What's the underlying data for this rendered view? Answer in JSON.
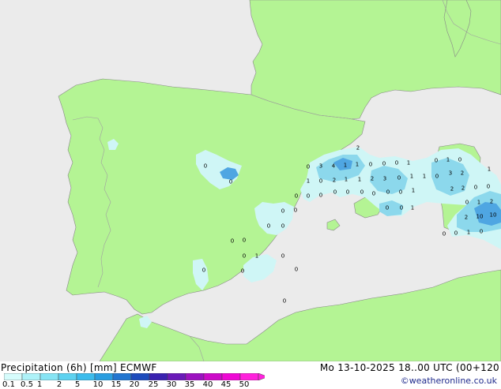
{
  "title": {
    "left": "Precipitation (6h) [mm] ECMWF",
    "right": "Mo 13-10-2025 18..00 UTC (00+120"
  },
  "credit": "©weatheronline.co.uk",
  "legend": {
    "ticks": [
      "0.1",
      "0.5",
      "1",
      "2",
      "5",
      "10",
      "15",
      "20",
      "25",
      "30",
      "35",
      "40",
      "45",
      "50"
    ],
    "colors": [
      "#d6fcfc",
      "#aef2f8",
      "#86e4f4",
      "#5ed2f0",
      "#3cbcec",
      "#2a9ee0",
      "#2276d0",
      "#1e4cbc",
      "#3a22b0",
      "#6a1ab8",
      "#9c12c0",
      "#cc0ac8",
      "#ee08d4",
      "#ff22dc"
    ]
  },
  "colors": {
    "sea": "#ebebeb",
    "land": "#b4f494",
    "border": "#a0a0a0",
    "coast": "#888888",
    "rain_light": "#cff6f6",
    "rain_mid": "#8cd8ec",
    "rain_heavy": "#4fa6e2"
  },
  "labels": [
    {
      "t": "2"
    },
    {
      "t": "0"
    },
    {
      "t": "3"
    },
    {
      "t": "4"
    },
    {
      "t": "1"
    },
    {
      "t": "1"
    },
    {
      "t": "0"
    },
    {
      "t": "0"
    },
    {
      "t": "0"
    },
    {
      "t": "1"
    },
    {
      "t": "1"
    },
    {
      "t": "0"
    },
    {
      "t": "2"
    },
    {
      "t": "1"
    },
    {
      "t": "1"
    },
    {
      "t": "2"
    },
    {
      "t": "3"
    },
    {
      "t": "0"
    },
    {
      "t": "1"
    },
    {
      "t": "1"
    },
    {
      "t": "0"
    },
    {
      "t": "0"
    },
    {
      "t": "0"
    },
    {
      "t": "0"
    },
    {
      "t": "0"
    },
    {
      "t": "0"
    },
    {
      "t": "0"
    },
    {
      "t": "0"
    },
    {
      "t": "0"
    },
    {
      "t": "0"
    },
    {
      "t": "1"
    },
    {
      "t": "0"
    },
    {
      "t": "0"
    },
    {
      "t": "0"
    },
    {
      "t": "0"
    },
    {
      "t": "0"
    },
    {
      "t": "0"
    },
    {
      "t": "0"
    },
    {
      "t": "0"
    },
    {
      "t": "0"
    },
    {
      "t": "1"
    },
    {
      "t": "0"
    },
    {
      "t": "0"
    },
    {
      "t": "0"
    },
    {
      "t": "0"
    },
    {
      "t": "3"
    },
    {
      "t": "2"
    },
    {
      "t": "1"
    },
    {
      "t": "2"
    },
    {
      "t": "2"
    },
    {
      "t": "0"
    },
    {
      "t": "0"
    },
    {
      "t": "0"
    },
    {
      "t": "1"
    },
    {
      "t": "2"
    },
    {
      "t": "2"
    },
    {
      "t": "10"
    },
    {
      "t": "10"
    },
    {
      "t": "0"
    },
    {
      "t": "0"
    },
    {
      "t": "1"
    },
    {
      "t": "0"
    },
    {
      "t": "0"
    },
    {
      "t": "1"
    },
    {
      "t": "0"
    },
    {
      "t": "0"
    },
    {
      "t": "0"
    },
    {
      "t": "1"
    },
    {
      "t": "0"
    }
  ]
}
